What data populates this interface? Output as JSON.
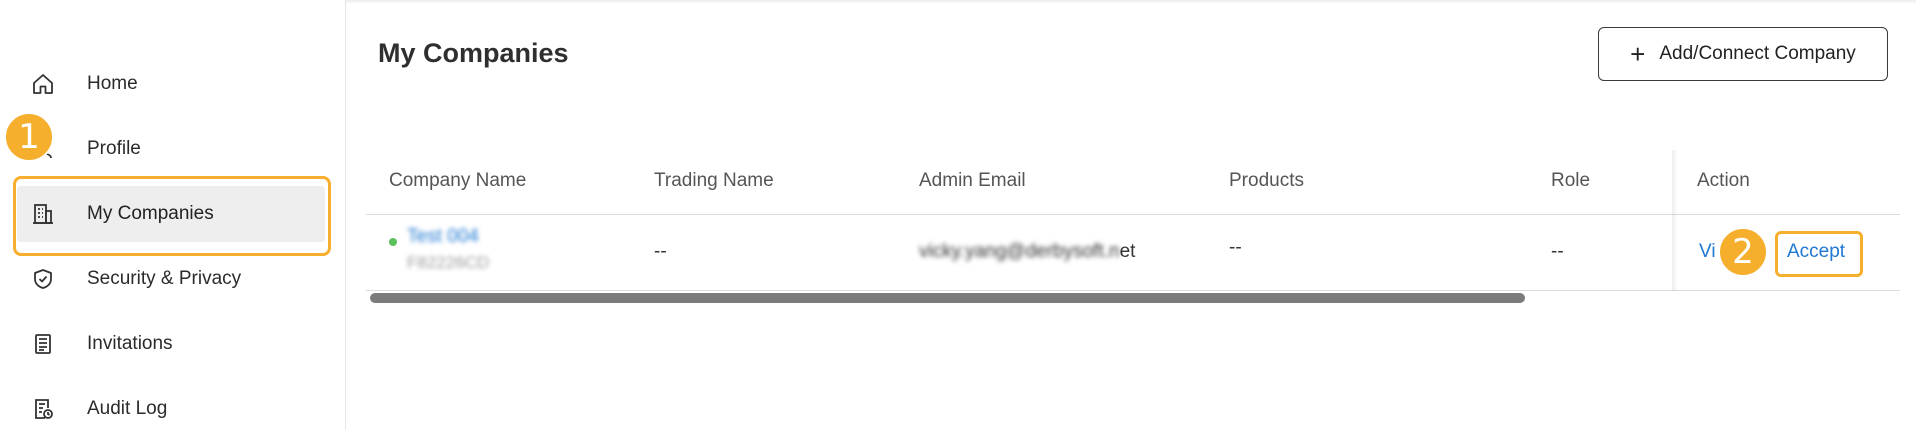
{
  "sidebar": {
    "items": [
      {
        "label": "Home",
        "icon": "home-icon"
      },
      {
        "label": "Profile",
        "icon": "user-icon"
      },
      {
        "label": "My Companies",
        "icon": "building-icon"
      },
      {
        "label": "Security & Privacy",
        "icon": "shield-check-icon"
      },
      {
        "label": "Invitations",
        "icon": "document-icon"
      },
      {
        "label": "Audit Log",
        "icon": "audit-log-icon"
      }
    ],
    "active": "My Companies"
  },
  "annotations": {
    "step1": "1",
    "step2": "2",
    "highlight_color": "#f6ae2d"
  },
  "main": {
    "title": "My Companies",
    "add_button_label": "Add/Connect Company",
    "table": {
      "headers": [
        "Company Name",
        "Trading Name",
        "Admin Email",
        "Products",
        "Role",
        "Action"
      ],
      "rows": [
        {
          "company_name": "Test 004",
          "company_code": "F82226CD",
          "trading_name": "--",
          "admin_email_blurred": "vicky.yang@derbysoft.n",
          "admin_email_tail": "et",
          "products": "--",
          "role": "--",
          "action_view": "Vi",
          "action_accept": "Accept",
          "status_color": "#5cc05c"
        }
      ]
    }
  },
  "colors": {
    "link": "#1f78d1",
    "active_bg": "#eeeeee"
  }
}
